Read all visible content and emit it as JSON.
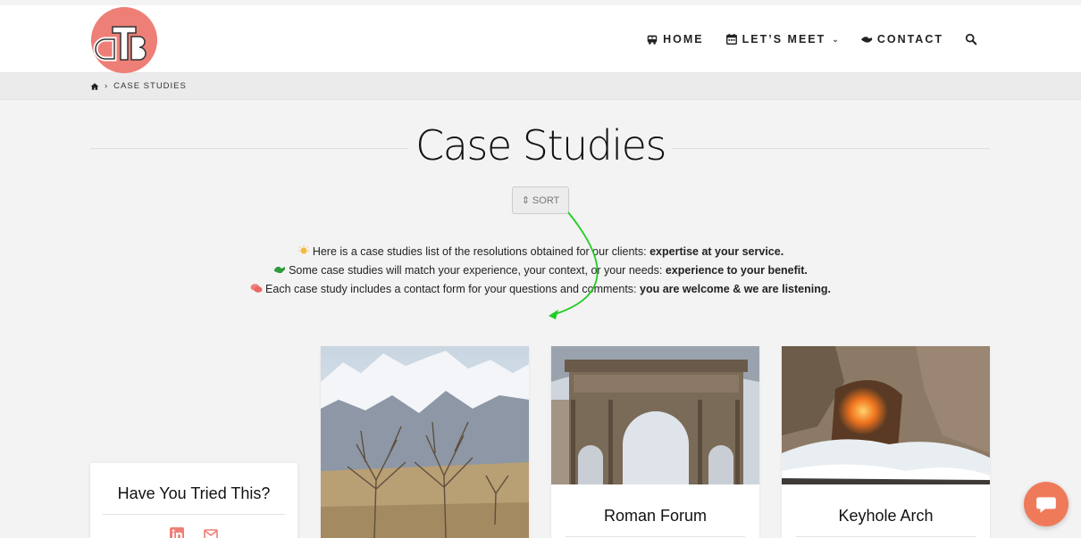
{
  "header": {
    "logo_text": "dTB",
    "nav": [
      {
        "label": "HOME",
        "icon": "bus-icon"
      },
      {
        "label": "LET’S MEET",
        "icon": "calendar-icon",
        "has_dropdown": true
      },
      {
        "label": "CONTACT",
        "icon": "handshake-icon"
      }
    ],
    "search_icon": "search-icon"
  },
  "breadcrumb": {
    "home_icon": "home-icon",
    "separator": "›",
    "current": "CASE STUDIES"
  },
  "page": {
    "title": "Case Studies",
    "sort_label": "SORT",
    "intro": [
      {
        "icon": "lightbulb-icon",
        "text": "Here is a case studies list of the resolutions obtained for our clients: ",
        "bold": "expertise at your service."
      },
      {
        "icon": "handshake-icon",
        "text": "Some case studies will match your experience, your context, or your needs: ",
        "bold": "experience to your benefit."
      },
      {
        "icon": "comments-icon",
        "text": "Each case study includes a contact form for your questions and comments: ",
        "bold": "you are welcome & we are listening."
      }
    ]
  },
  "sidebar": {
    "title": "Have You Tried This?",
    "social": [
      "linkedin-icon",
      "email-icon"
    ]
  },
  "cards": [
    {
      "title": "",
      "image": "mountain-trees-image"
    },
    {
      "title": "Roman Forum",
      "image": "roman-arch-image"
    },
    {
      "title": "Keyhole Arch",
      "image": "keyhole-arch-image"
    }
  ],
  "colors": {
    "brand": "#ee7f77",
    "chat": "#ef7a5a",
    "arrow": "#22cc22"
  }
}
